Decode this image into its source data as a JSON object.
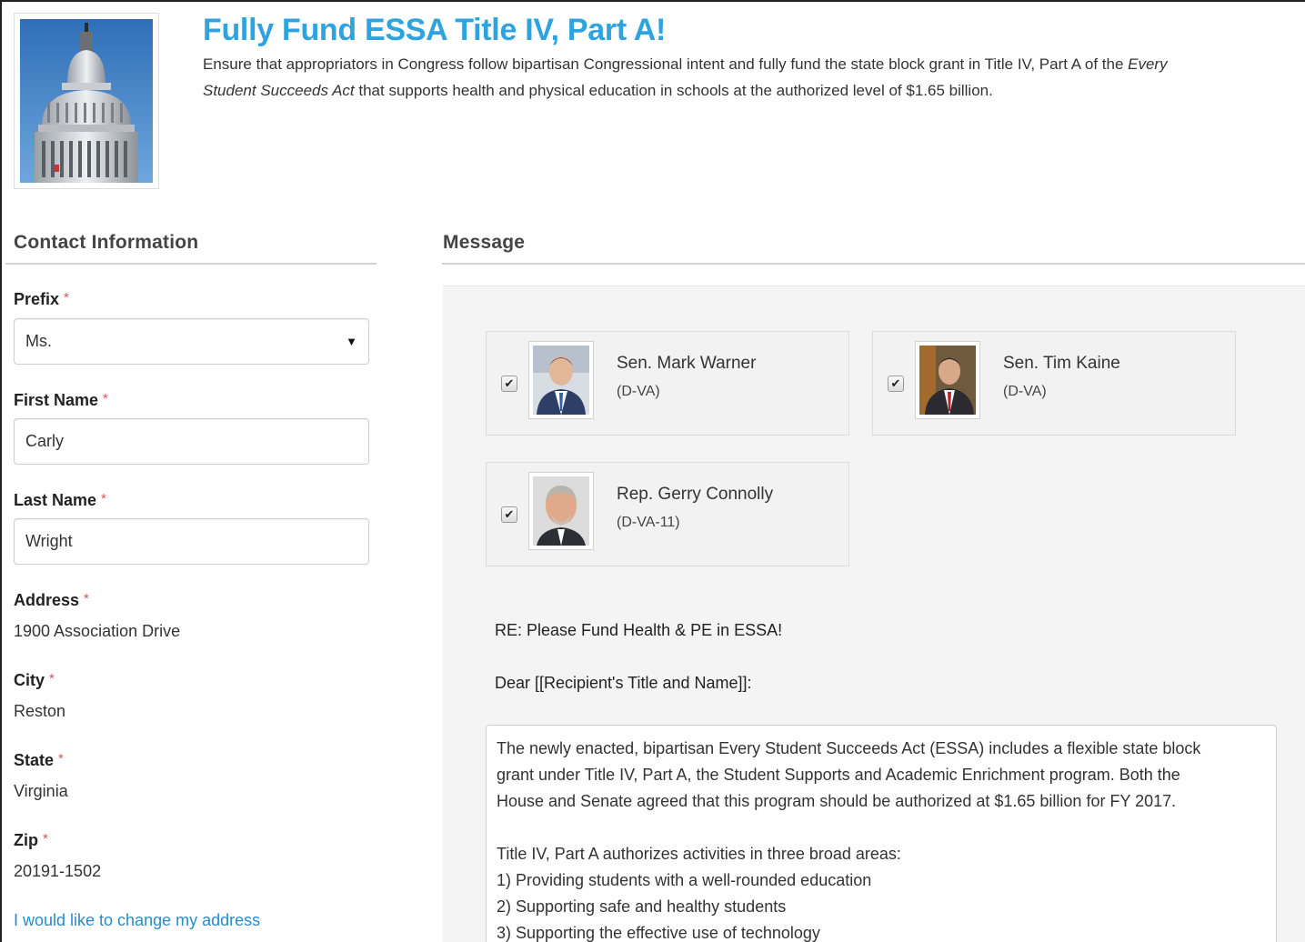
{
  "campaign": {
    "title": "Fully Fund ESSA Title IV, Part A!",
    "intro_line1_pre": "Ensure that appropriators in Congress follow bipartisan Congressional intent and fully fund the state block grant in Title IV, Part A of the ",
    "intro_line1_italic": "Every",
    "intro_line2_italic": "Student Succeeds Act",
    "intro_line2_post": " that supports health and physical education in schools at the authorized level of $1.65 billion.",
    "photo_icon": "capitol-dome-photo"
  },
  "contact": {
    "heading": "Contact Information",
    "required_mark": "*",
    "prefix": {
      "label": "Prefix",
      "value": "Ms."
    },
    "first_name": {
      "label": "First Name",
      "value": "Carly"
    },
    "last_name": {
      "label": "Last Name",
      "value": "Wright"
    },
    "address": {
      "label": "Address",
      "value": "1900 Association Drive"
    },
    "city": {
      "label": "City",
      "value": "Reston"
    },
    "state": {
      "label": "State",
      "value": "Virginia"
    },
    "zip": {
      "label": "Zip",
      "value": "20191-1502"
    },
    "change_address_link": "I would like to change my address"
  },
  "message": {
    "heading": "Message",
    "recipients": [
      {
        "name": "Sen. Mark Warner",
        "party": "(D-VA)",
        "checked": true
      },
      {
        "name": "Sen. Tim Kaine",
        "party": "(D-VA)",
        "checked": true
      },
      {
        "name": "Rep. Gerry Connolly",
        "party": "(D-VA-11)",
        "checked": true
      }
    ],
    "subject": "RE: Please Fund Health & PE in ESSA!",
    "salutation": "Dear [[Recipient's Title and Name]]:",
    "body": [
      "The newly enacted, bipartisan Every Student Succeeds Act (ESSA) includes a flexible state block",
      "grant under Title IV, Part A, the Student Supports and Academic Enrichment program. Both the",
      "House and Senate agreed that this program should be authorized at $1.65 billion for FY 2017.",
      "Title IV, Part A authorizes activities in three broad areas:",
      "1) Providing students with a well-rounded education",
      "2) Supporting safe and healthy students",
      "3) Supporting the effective use of technology"
    ]
  },
  "colors": {
    "title": "#2ea3e0",
    "link": "#2a8bc9",
    "required": "#d9534f"
  }
}
